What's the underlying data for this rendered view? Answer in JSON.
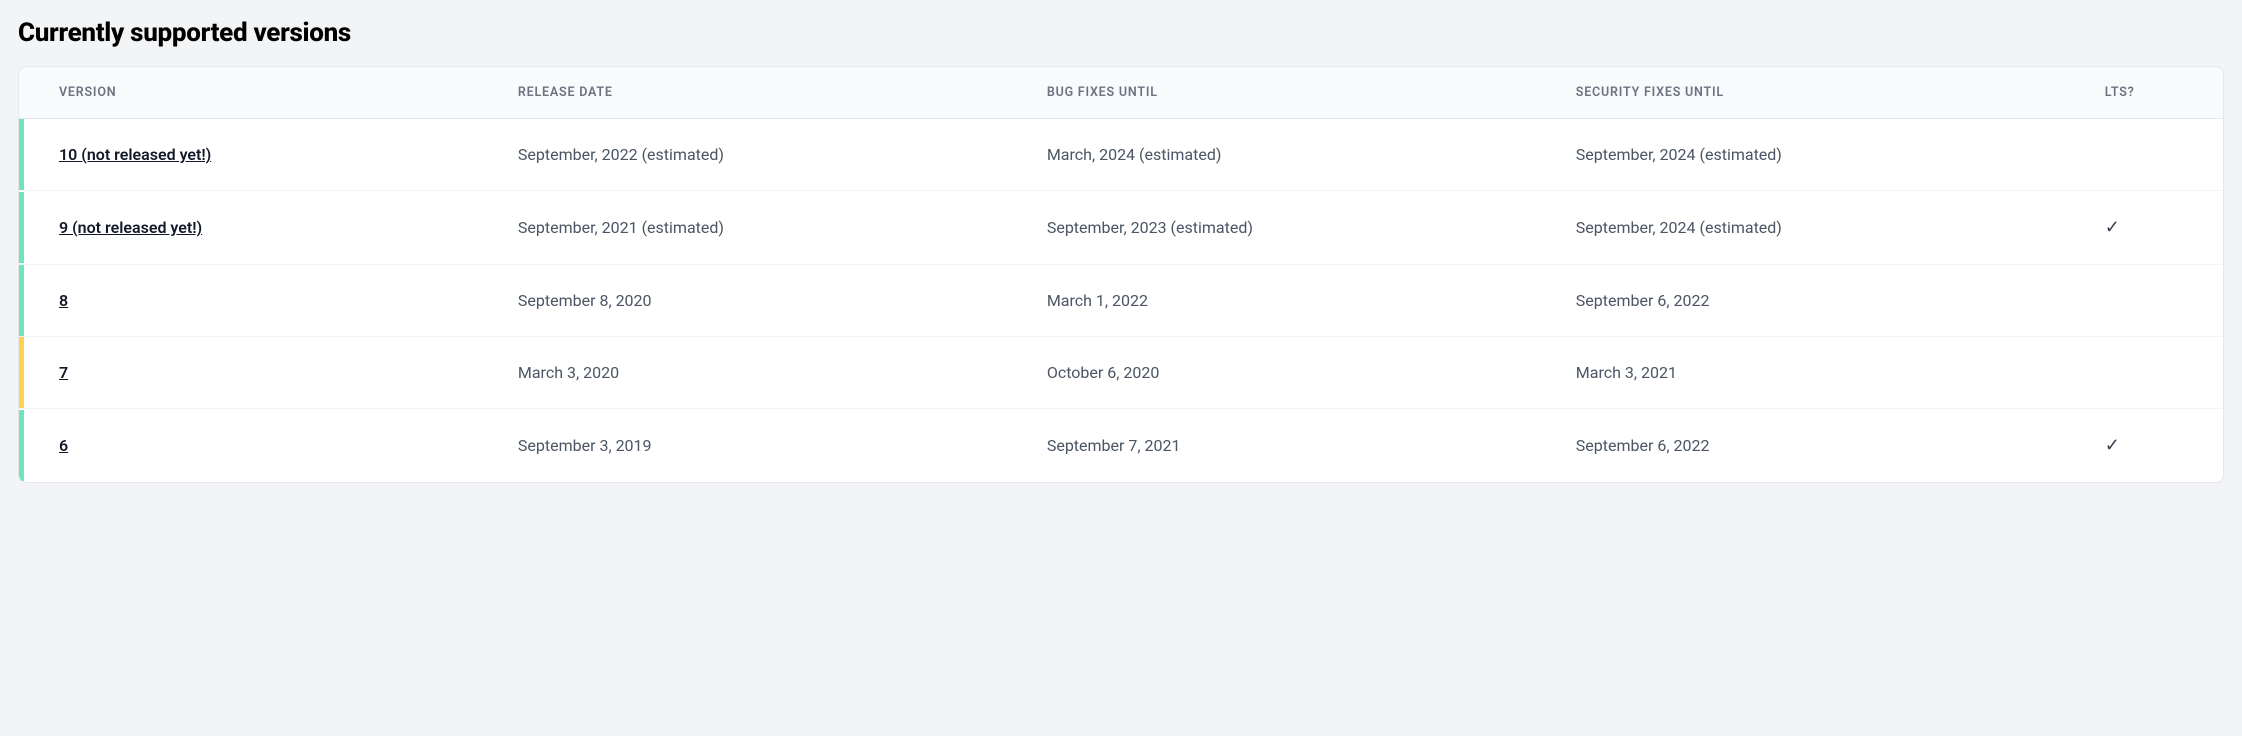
{
  "heading": "Currently supported versions",
  "columns": {
    "version": "VERSION",
    "release": "RELEASE DATE",
    "bug": "BUG FIXES UNTIL",
    "security": "SECURITY FIXES UNTIL",
    "lts": "LTS?"
  },
  "rows": [
    {
      "status": "green",
      "version": "10 (not released yet!)",
      "release": "September, 2022 (estimated)",
      "bug": "March, 2024 (estimated)",
      "security": "September, 2024 (estimated)",
      "lts": ""
    },
    {
      "status": "green",
      "version": "9 (not released yet!)",
      "release": "September, 2021 (estimated)",
      "bug": "September, 2023 (estimated)",
      "security": "September, 2024 (estimated)",
      "lts": "✓"
    },
    {
      "status": "green",
      "version": "8",
      "release": "September 8, 2020",
      "bug": "March 1, 2022",
      "security": "September 6, 2022",
      "lts": ""
    },
    {
      "status": "yellow",
      "version": "7",
      "release": "March 3, 2020",
      "bug": "October 6, 2020",
      "security": "March 3, 2021",
      "lts": ""
    },
    {
      "status": "green",
      "version": "6",
      "release": "September 3, 2019",
      "bug": "September 7, 2021",
      "security": "September 6, 2022",
      "lts": "✓"
    }
  ]
}
